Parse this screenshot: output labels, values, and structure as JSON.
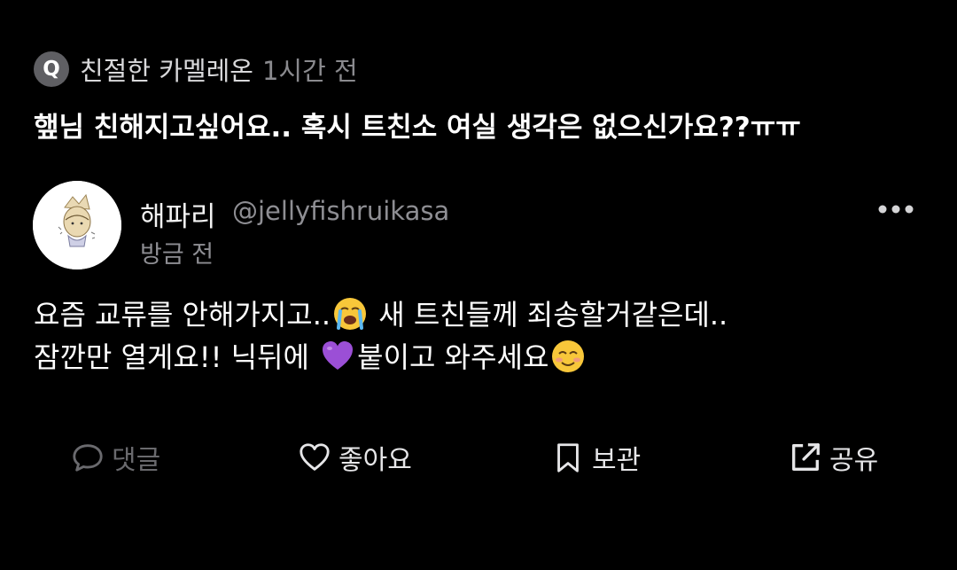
{
  "question": {
    "badge": "Q",
    "asker_name": "친절한 카멜레온",
    "time": "1시간 전",
    "text": "햎님 친해지고싶어요.. 혹시 트친소 여실 생각은 없으신가요??ㅠㅠ"
  },
  "answer": {
    "display_name": "해파리",
    "handle": "@jellyfishruikasa",
    "time": "방금 전",
    "line1_a": "요즘 교류를 안해가지고..",
    "line1_b": " 새 트친들께 죄송할거같은데..",
    "line2_a": "잠깐만 열게요!! 닉뒤에 ",
    "line2_b": "붙이고 와주세요",
    "emoji_1": "loudly-crying-face",
    "emoji_2": "purple-heart",
    "emoji_3": "smiling-face"
  },
  "actions": {
    "comment": "댓글",
    "like": "좋아요",
    "save": "보관",
    "share": "공유"
  },
  "colors": {
    "background": "#000000",
    "primary_text": "#ffffff",
    "secondary_text": "#8e8e93",
    "disabled": "#6a6a6e",
    "badge": "#5f5f63"
  },
  "icons": {
    "more": "more-horizontal-icon",
    "comment": "speech-bubble-icon",
    "like": "heart-icon",
    "save": "bookmark-icon",
    "share": "share-external-icon"
  }
}
